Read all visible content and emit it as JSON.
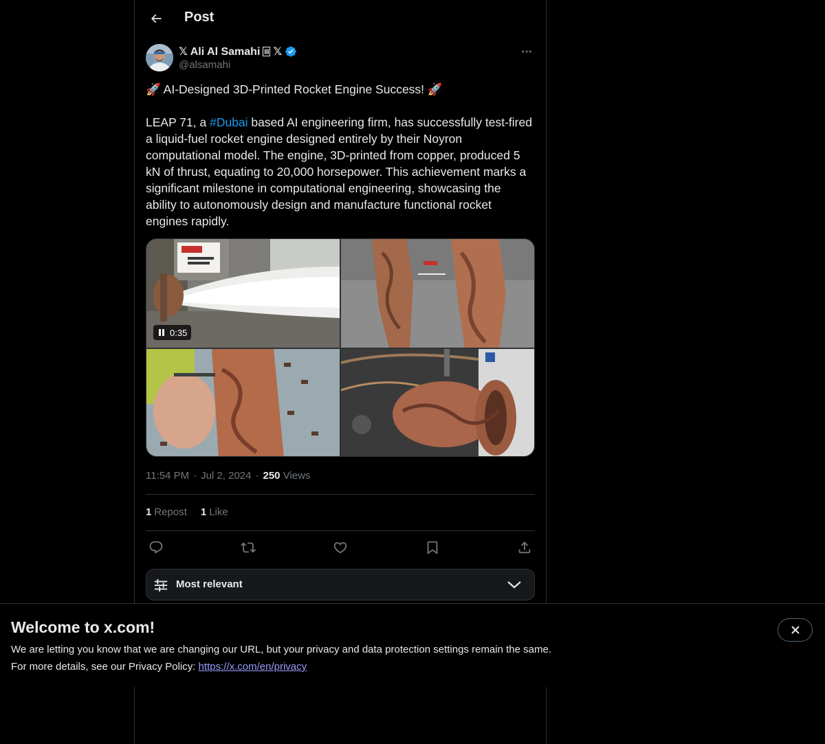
{
  "header": {
    "title": "Post"
  },
  "author": {
    "name": "𝕏 Ali Al Samahi",
    "name_suffix": "𝕏",
    "handle": "@alsamahi"
  },
  "tweet": {
    "headline": "🚀 AI-Designed 3D-Printed Rocket Engine Success! 🚀",
    "body_prefix": "LEAP 71, a ",
    "hashtag": "#Dubai",
    "body_suffix": " based AI engineering firm, has successfully test-fired a liquid-fuel rocket engine designed entirely by their Noyron computational model. The engine, 3D-printed from copper, produced 5 kN of thrust, equating to 20,000 horsepower. This achievement marks a significant milestone in computational engineering, showcasing the ability to autonomously design and manufacture functional rocket engines rapidly."
  },
  "media": {
    "video_duration": "0:35",
    "items": [
      "rocket-engine-test-fire-video",
      "printed-engines-photo",
      "engine-handheld-photo",
      "engine-test-rig-photo"
    ]
  },
  "meta": {
    "time": "11:54 PM",
    "separator": "·",
    "date": "Jul 2, 2024",
    "views_count": "250",
    "views_label": "Views"
  },
  "stats": {
    "reposts_count": "1",
    "reposts_label": "Repost",
    "likes_count": "1",
    "likes_label": "Like"
  },
  "sort": {
    "label": "Most relevant"
  },
  "banner": {
    "title": "Welcome to x.com!",
    "line1": "We are letting you know that we are changing our URL, but your privacy and data protection settings remain the same.",
    "line2_prefix": "For more details, see our Privacy Policy: ",
    "link": "https://x.com/en/privacy"
  },
  "colors": {
    "background": "#000000",
    "text": "#e7e9ea",
    "muted": "#71767b",
    "accent": "#1d9bf0",
    "border": "#2f3336"
  },
  "icons": [
    "back-arrow-icon",
    "verified-badge-icon",
    "more-icon",
    "pause-icon",
    "reply-icon",
    "repost-icon",
    "like-icon",
    "bookmark-icon",
    "share-icon",
    "sliders-icon",
    "chevron-down-icon",
    "close-icon"
  ]
}
